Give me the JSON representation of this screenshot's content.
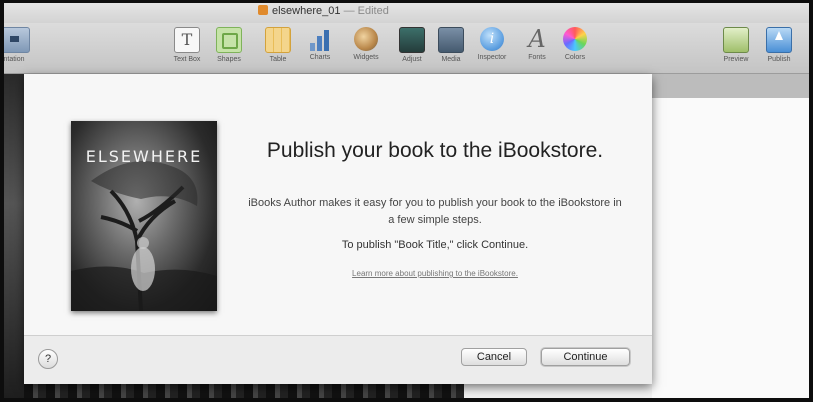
{
  "window": {
    "title": "elsewhere_01",
    "edited": "— Edited"
  },
  "toolbar": {
    "left_item": "ntation",
    "items": [
      {
        "label": "Text Box",
        "icon": "text-box-icon"
      },
      {
        "label": "Shapes",
        "icon": "shapes-icon"
      },
      {
        "label": "Table",
        "icon": "table-icon"
      },
      {
        "label": "Charts",
        "icon": "charts-icon"
      },
      {
        "label": "Widgets",
        "icon": "widgets-icon"
      },
      {
        "label": "Adjust",
        "icon": "adjust-icon"
      },
      {
        "label": "Media",
        "icon": "media-icon"
      },
      {
        "label": "Inspector",
        "icon": "inspector-icon"
      },
      {
        "label": "Fonts",
        "icon": "fonts-icon"
      },
      {
        "label": "Colors",
        "icon": "colors-icon"
      }
    ],
    "right_items": [
      {
        "label": "Preview",
        "icon": "preview-icon"
      },
      {
        "label": "Publish",
        "icon": "publish-icon"
      }
    ]
  },
  "sheet": {
    "cover_title": "ELSEWHERE",
    "heading": "Publish your book to the iBookstore.",
    "description": "iBooks Author makes it easy for you to publish your book to the iBookstore in a few simple steps.",
    "call_to_action": "To publish \"Book Title,\" click Continue.",
    "learn_more_link": "Learn more about publishing to the iBookstore.",
    "help_label": "?",
    "cancel_label": "Cancel",
    "continue_label": "Continue"
  }
}
